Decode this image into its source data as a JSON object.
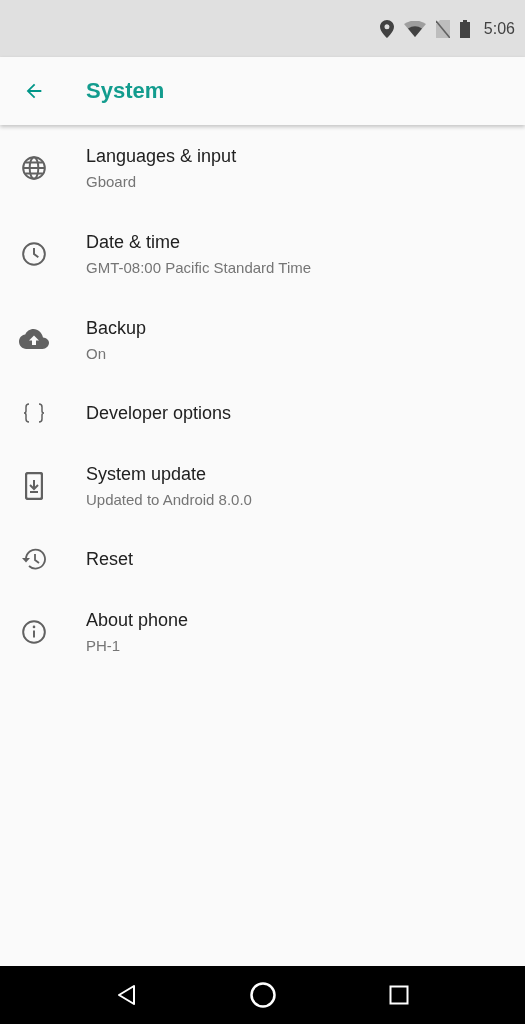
{
  "status_bar": {
    "time": "5:06"
  },
  "app_bar": {
    "title": "System"
  },
  "items": [
    {
      "kind": "globe",
      "title": "Languages & input",
      "summary": "Gboard"
    },
    {
      "kind": "clock",
      "title": "Date & time",
      "summary": "GMT-08:00 Pacific Standard Time"
    },
    {
      "kind": "cloud",
      "title": "Backup",
      "summary": "On"
    },
    {
      "kind": "braces",
      "title": "Developer options"
    },
    {
      "kind": "phone",
      "title": "System update",
      "summary": "Updated to Android 8.0.0"
    },
    {
      "kind": "history",
      "title": "Reset"
    },
    {
      "kind": "info",
      "title": "About phone",
      "summary": "PH-1"
    }
  ]
}
